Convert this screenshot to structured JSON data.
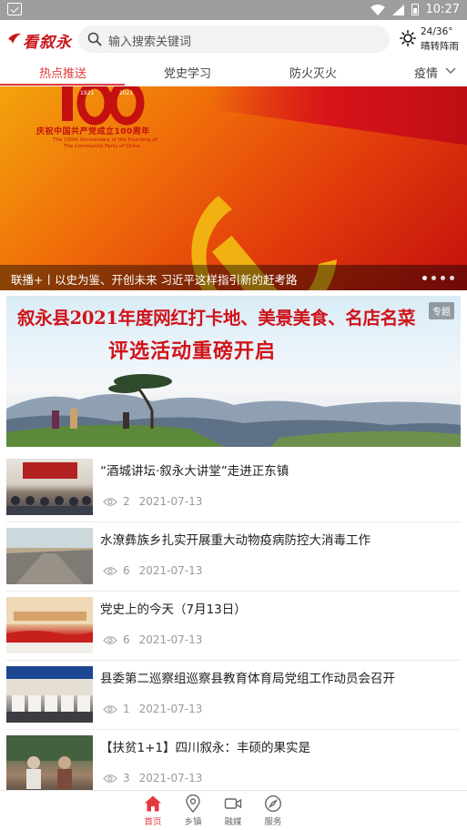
{
  "status_bar": {
    "time": "10:27"
  },
  "header": {
    "logo_text": "看叙永",
    "search_placeholder": "输入搜索关键词",
    "weather": {
      "temp": "24/36°",
      "condition": "晴转阵雨"
    }
  },
  "tabs": [
    {
      "label": "热点推送",
      "active": true
    },
    {
      "label": "党史学习",
      "active": false
    },
    {
      "label": "防火灭火",
      "active": false
    },
    {
      "label": "疫情",
      "active": false
    }
  ],
  "banner": {
    "caption": "联播+丨以史为鉴、开创未来 习近平这样指引新的赶考路",
    "image_text": {
      "years": [
        "1921",
        "2021"
      ],
      "headline": "庆祝中国共产党成立100周年",
      "english_line1": "The 100th Anniversary of the Founding of",
      "english_line2": "The Communist Party of China"
    },
    "dots_total": 4,
    "dots_active_index": 0
  },
  "promo": {
    "line1": "叙永县2021年度网红打卡地、美景美食、名店名菜",
    "line2": "评选活动重磅开启",
    "badge": "专题"
  },
  "news": [
    {
      "title": "“酒城讲坛·叙永大讲堂”走进正东镇",
      "views": "2",
      "date": "2021-07-13"
    },
    {
      "title": "水潦彝族乡扎实开展重大动物疫病防控大消毒工作",
      "views": "6",
      "date": "2021-07-13"
    },
    {
      "title": "党史上的今天（7月13日）",
      "views": "6",
      "date": "2021-07-13"
    },
    {
      "title": "县委第二巡察组巡察县教育体育局党组工作动员会召开",
      "views": "1",
      "date": "2021-07-13"
    },
    {
      "title": "【扶贫1+1】四川叙永：丰硕的果实是",
      "views": "3",
      "date": "2021-07-13"
    }
  ],
  "bottom_nav": [
    {
      "label": "首页",
      "icon": "home-icon",
      "active": true
    },
    {
      "label": "乡镇",
      "icon": "location-pin-icon",
      "active": false
    },
    {
      "label": "融媒",
      "icon": "video-camera-icon",
      "active": false
    },
    {
      "label": "服务",
      "icon": "compass-icon",
      "active": false
    }
  ],
  "colors": {
    "accent": "#e4393c",
    "brand_red": "#c8161d"
  }
}
